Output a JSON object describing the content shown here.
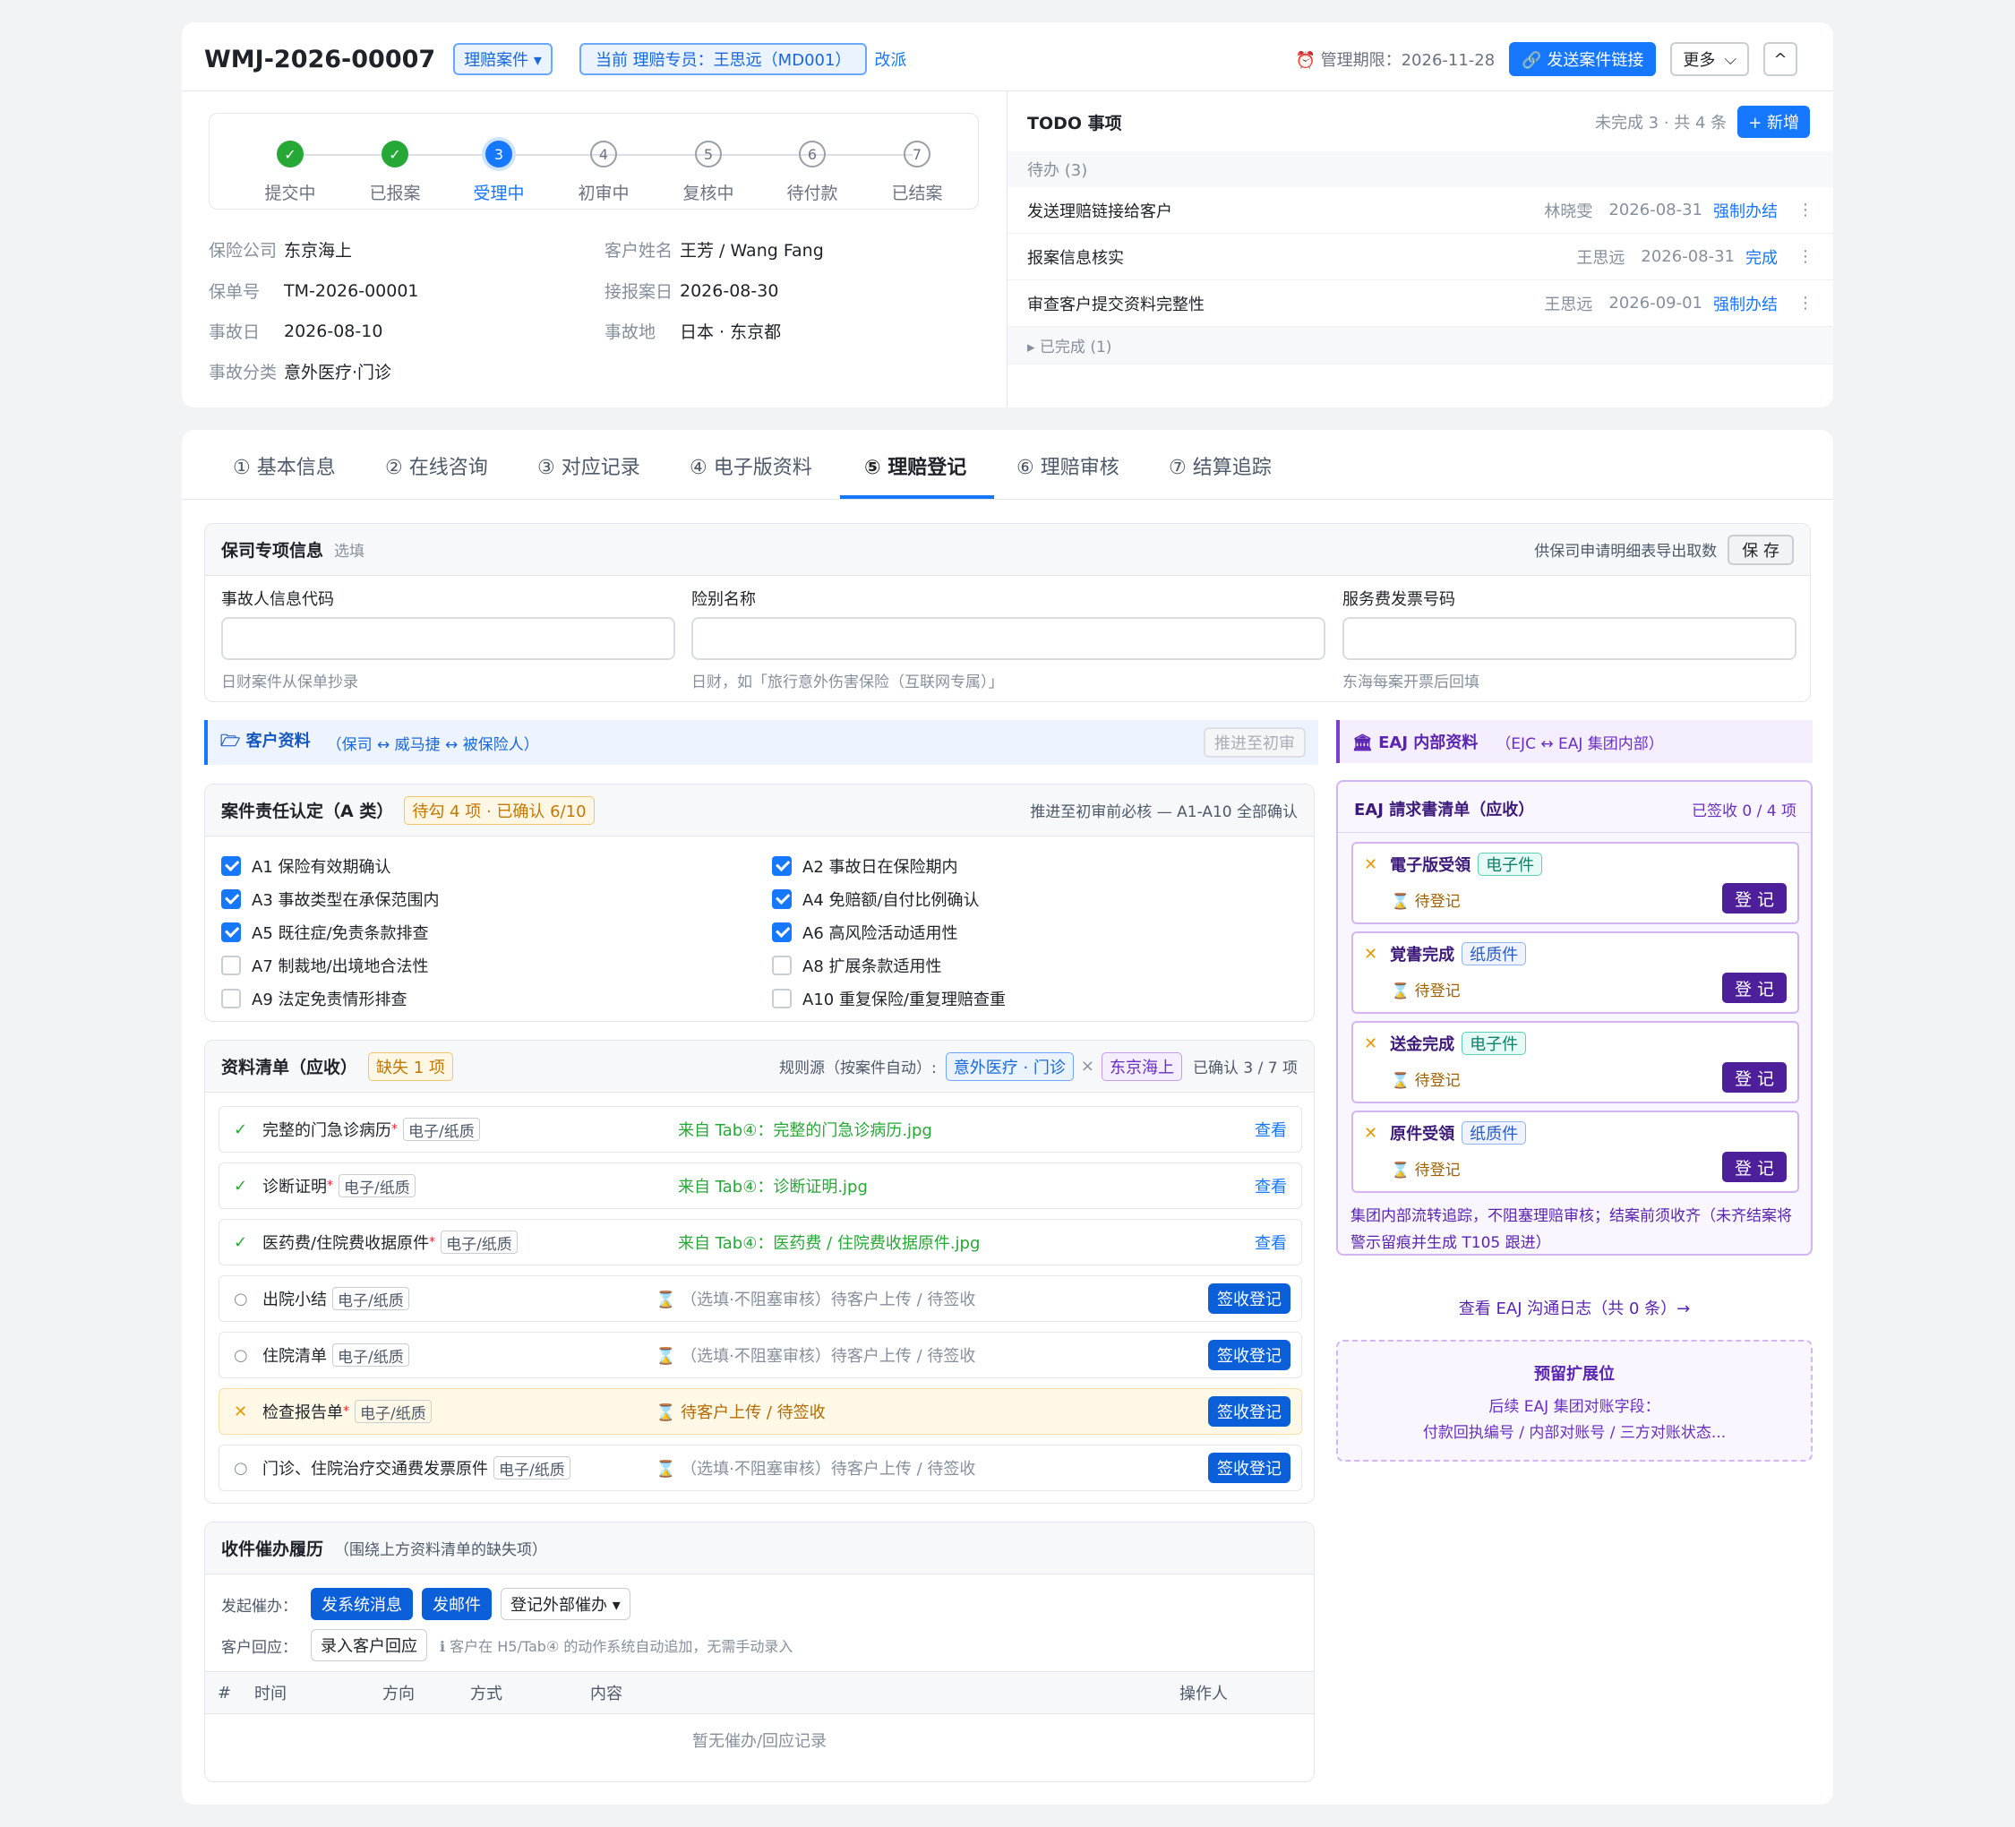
{
  "header": {
    "case_no": "WMJ-2026-00007",
    "case_type": "理赔案件 ▾",
    "handler": "当前 理赔专员：王思远（MD001）",
    "reassign": "改派",
    "deadline": "⏰ 管理期限：2026-11-28",
    "send_link": "🔗 发送案件链接",
    "more": "更多",
    "collapse": "^"
  },
  "steps": [
    {
      "n": "✓",
      "label": "提交中",
      "state": "done"
    },
    {
      "n": "✓",
      "label": "已报案",
      "state": "done"
    },
    {
      "n": "3",
      "label": "受理中",
      "state": "cur"
    },
    {
      "n": "4",
      "label": "初审中",
      "state": "todo"
    },
    {
      "n": "5",
      "label": "复核中",
      "state": "todo"
    },
    {
      "n": "6",
      "label": "待付款",
      "state": "todo"
    },
    {
      "n": "7",
      "label": "已结案",
      "state": "todo"
    }
  ],
  "info": {
    "l1": "保险公司",
    "v1": "东京海上",
    "l2": "客户姓名",
    "v2": "王芳 / Wang Fang",
    "l3": "保单号",
    "v3": "TM-2026-00001",
    "l4": "接报案日",
    "v4": "2026-08-30",
    "l5": "事故日",
    "v5": "2026-08-10",
    "l6": "事故地",
    "v6": "日本 · 东京都",
    "l7": "事故分类",
    "v7": "意外医疗·门诊"
  },
  "todo": {
    "title": "TODO 事项",
    "summary": "未完成 3 · 共 4 条",
    "add": "+ 新增",
    "pending": "待办 (3)",
    "done": "▸ 已完成 (1)",
    "items": [
      {
        "text": "发送理赔链接给客户",
        "who": "林晓雯",
        "date": "2026-08-31",
        "action": "强制办结"
      },
      {
        "text": "报案信息核实",
        "who": "王思远",
        "date": "2026-08-31",
        "action": "完成"
      },
      {
        "text": "审查客户提交资料完整性",
        "who": "王思远",
        "date": "2026-09-01",
        "action": "强制办结"
      }
    ]
  },
  "tabs": [
    "① 基本信息",
    "② 在线咨询",
    "③ 对应记录",
    "④ 电子版资料",
    "⑤ 理赔登记",
    "⑥ 理赔审核",
    "⑦ 结算追踪"
  ],
  "insurer_info": {
    "title": "保司专项信息",
    "optional": "选填",
    "note": "供保司申请明细表导出取数",
    "save": "保 存",
    "f1_label": "事故人信息代码",
    "f1_hint": "日财案件从保单抄录",
    "f2_label": "险别名称",
    "f2_hint": "日财，如「旅行意外伤害保险（互联网专属）」",
    "f3_label": "服务费发票号码",
    "f3_hint": "东海每案开票后回填"
  },
  "customer": {
    "title": "🗁 客户资料",
    "sub": "（保司 ↔ 威马捷 ↔ 被保险人）",
    "push": "推进至初审"
  },
  "liability": {
    "title": "案件责任认定（A 类）",
    "badge": "待勾 4 项 · 已确认 6/10",
    "note": "推进至初审前必核 — A1-A10 全部确认",
    "items": [
      {
        "t": "A1 保险有效期确认",
        "c": true
      },
      {
        "t": "A2 事故日在保险期内",
        "c": true
      },
      {
        "t": "A3 事故类型在承保范围内",
        "c": true
      },
      {
        "t": "A4 免赔额/自付比例确认",
        "c": true
      },
      {
        "t": "A5 既往症/免责条款排查",
        "c": true
      },
      {
        "t": "A6 高风险活动适用性",
        "c": true
      },
      {
        "t": "A7 制裁地/出境地合法性",
        "c": false
      },
      {
        "t": "A8 扩展条款适用性",
        "c": false
      },
      {
        "t": "A9 法定免责情形排查",
        "c": false
      },
      {
        "t": "A10 重复保险/重复理赔查重",
        "c": false
      }
    ]
  },
  "docs": {
    "title": "资料清单（应收）",
    "badge": "缺失 1 项",
    "rule": "规则源（按案件自动）:",
    "rule_a": "意外医疗 · 门诊",
    "rule_x": "×",
    "rule_b": "东京海上",
    "confirmed": "已确认 3 / 7 项",
    "items": [
      {
        "icon": "✓",
        "name": "完整的门急诊病历",
        "req": "*",
        "type": "电子/纸质",
        "status": "来自 Tab④：完整的门急诊病历.jpg",
        "action": "查看",
        "state": "ok"
      },
      {
        "icon": "✓",
        "name": "诊断证明",
        "req": "*",
        "type": "电子/纸质",
        "status": "来自 Tab④：诊断证明.jpg",
        "action": "查看",
        "state": "ok"
      },
      {
        "icon": "✓",
        "name": "医药费/住院费收据原件",
        "req": "*",
        "type": "电子/纸质",
        "status": "来自 Tab④：医药费 / 住院费收据原件.jpg",
        "action": "查看",
        "state": "ok"
      },
      {
        "icon": "○",
        "name": "出院小结",
        "req": "",
        "type": "电子/纸质",
        "status": "⌛ （选填·不阻塞审核）待客户上传 / 待签收",
        "action": "签收登记",
        "state": "opt"
      },
      {
        "icon": "○",
        "name": "住院清单",
        "req": "",
        "type": "电子/纸质",
        "status": "⌛ （选填·不阻塞审核）待客户上传 / 待签收",
        "action": "签收登记",
        "state": "opt"
      },
      {
        "icon": "✕",
        "name": "检查报告单",
        "req": "*",
        "type": "电子/纸质",
        "status": "⌛ 待客户上传 / 待签收",
        "action": "签收登记",
        "state": "miss"
      },
      {
        "icon": "○",
        "name": "门诊、住院治疗交通费发票原件",
        "req": "",
        "type": "电子/纸质",
        "status": "⌛ （选填·不阻塞审核）待客户上传 / 待签收",
        "action": "签收登记",
        "state": "opt"
      }
    ]
  },
  "followup": {
    "title": "收件催办履历",
    "sub": "（围绕上方资料清单的缺失项）",
    "l1": "发起催办：",
    "b1": "发系统消息",
    "b2": "发邮件",
    "b3": "登记外部催办 ▾",
    "l2": "客户回应：",
    "b4": "录入客户回应",
    "hint": "ℹ 客户在 H5/Tab④ 的动作系统自动追加，无需手动录入",
    "cols": [
      "#",
      "时间",
      "方向",
      "方式",
      "内容",
      "操作人"
    ],
    "empty": "暂无催办/回应记录"
  },
  "eaj": {
    "title": "🏛 EAJ 内部资料",
    "sub": "（EJC ↔ EAJ 集团内部）",
    "list_title": "EAJ 請求書清单（应收）",
    "list_count": "已签收 0 / 4 项",
    "items": [
      {
        "name": "電子版受領",
        "type": "电子件",
        "status": "⌛ 待登记",
        "btn": "登 记",
        "kind": "e"
      },
      {
        "name": "覚書完成",
        "type": "纸质件",
        "status": "⌛ 待登记",
        "btn": "登 记",
        "kind": "p"
      },
      {
        "name": "送金完成",
        "type": "电子件",
        "status": "⌛ 待登记",
        "btn": "登 记",
        "kind": "e"
      },
      {
        "name": "原件受領",
        "type": "纸质件",
        "status": "⌛ 待登记",
        "btn": "登 记",
        "kind": "p"
      }
    ],
    "note": "集团内部流转追踪，不阻塞理赔审核；结案前须收齐（未齐结案将警示留痕并生成 T105 跟进）",
    "log_link": "查看 EAJ 沟通日志（共 0 条）→",
    "reserve_title": "预留扩展位",
    "reserve_l1": "后续 EAJ 集团对账字段：",
    "reserve_l2": "付款回执编号 / 内部对账号 / 三方对账状态..."
  }
}
